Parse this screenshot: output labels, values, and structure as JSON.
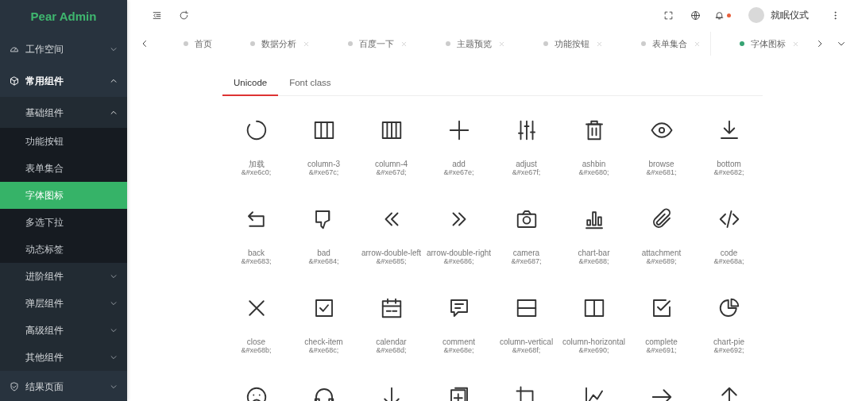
{
  "sidebar": {
    "logo": "Pear Admin",
    "items": [
      {
        "label": "工作空间",
        "expanded": false,
        "selected": false
      },
      {
        "label": "常用组件",
        "expanded": true,
        "selected": false,
        "children": [
          {
            "label": "基础组件",
            "expanded": true,
            "selected": false,
            "children": [
              {
                "label": "功能按钮",
                "selected": false
              },
              {
                "label": "表单集合",
                "selected": false
              },
              {
                "label": "字体图标",
                "selected": true
              },
              {
                "label": "多选下拉",
                "selected": false
              },
              {
                "label": "动态标签",
                "selected": false
              }
            ]
          },
          {
            "label": "进阶组件",
            "expanded": false,
            "selected": false
          },
          {
            "label": "弹层组件",
            "expanded": false,
            "selected": false
          },
          {
            "label": "高级组件",
            "expanded": false,
            "selected": false
          },
          {
            "label": "其他组件",
            "expanded": false,
            "selected": false
          }
        ]
      },
      {
        "label": "结果页面",
        "expanded": false,
        "selected": false
      }
    ]
  },
  "header": {
    "notification_dot": true,
    "username": "就眠仪式"
  },
  "page_tabs": [
    {
      "label": "首页",
      "selected": false,
      "closable": false
    },
    {
      "label": "数据分析",
      "selected": false,
      "closable": true
    },
    {
      "label": "百度一下",
      "selected": false,
      "closable": true
    },
    {
      "label": "主题预览",
      "selected": false,
      "closable": true
    },
    {
      "label": "功能按钮",
      "selected": false,
      "closable": true
    },
    {
      "label": "表单集合",
      "selected": false,
      "closable": true
    },
    {
      "label": "字体图标",
      "selected": true,
      "closable": true
    }
  ],
  "content_tabs": [
    {
      "label": "Unicode",
      "selected": true
    },
    {
      "label": "Font class",
      "selected": false
    }
  ],
  "icons": [
    {
      "kind": "full",
      "name": "加载",
      "code": "&#xe6c0;"
    },
    {
      "kind": "full",
      "name": "column-3",
      "code": "&#xe67c;"
    },
    {
      "kind": "full",
      "name": "column-4",
      "code": "&#xe67d;"
    },
    {
      "kind": "full",
      "name": "add",
      "code": "&#xe67e;"
    },
    {
      "kind": "full",
      "name": "adjust",
      "code": "&#xe67f;"
    },
    {
      "kind": "full",
      "name": "ashbin",
      "code": "&#xe680;"
    },
    {
      "kind": "full",
      "name": "browse",
      "code": "&#xe681;"
    },
    {
      "kind": "full",
      "name": "bottom",
      "code": "&#xe682;"
    },
    {
      "kind": "full",
      "name": "back",
      "code": "&#xe683;"
    },
    {
      "kind": "full",
      "name": "bad",
      "code": "&#xe684;"
    },
    {
      "kind": "full",
      "name": "arrow-double-left",
      "code": "&#xe685;"
    },
    {
      "kind": "full",
      "name": "arrow-double-right",
      "code": "&#xe686;"
    },
    {
      "kind": "full",
      "name": "camera",
      "code": "&#xe687;"
    },
    {
      "kind": "full",
      "name": "chart-bar",
      "code": "&#xe688;"
    },
    {
      "kind": "full",
      "name": "attachment",
      "code": "&#xe689;"
    },
    {
      "kind": "full",
      "name": "code",
      "code": "&#xe68a;"
    },
    {
      "kind": "full",
      "name": "close",
      "code": "&#xe68b;"
    },
    {
      "kind": "full",
      "name": "check-item",
      "code": "&#xe68c;"
    },
    {
      "kind": "full",
      "name": "calendar",
      "code": "&#xe68d;"
    },
    {
      "kind": "full",
      "name": "comment",
      "code": "&#xe68e;"
    },
    {
      "kind": "full",
      "name": "column-vertical",
      "code": "&#xe68f;"
    },
    {
      "kind": "full",
      "name": "column-horizontal",
      "code": "&#xe690;"
    },
    {
      "kind": "full",
      "name": "complete",
      "code": "&#xe691;"
    },
    {
      "kind": "full",
      "name": "chart-pie",
      "code": "&#xe692;"
    },
    {
      "kind": "cut"
    },
    {
      "kind": "cut"
    },
    {
      "kind": "cut"
    },
    {
      "kind": "cut"
    },
    {
      "kind": "cut"
    },
    {
      "kind": "cut"
    },
    {
      "kind": "cut"
    },
    {
      "kind": "cut"
    }
  ]
}
